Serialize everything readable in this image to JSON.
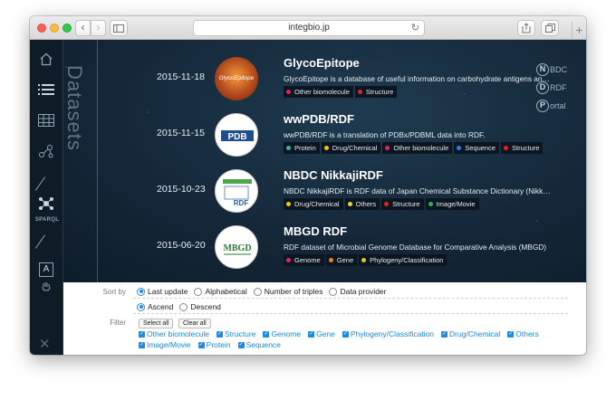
{
  "browser": {
    "url": "integbio.jp",
    "back": "‹",
    "forward": "›",
    "reload": "↻",
    "new_tab": "+"
  },
  "sidebar": {
    "sparql_label": "SPARQL",
    "box_label": "A",
    "vertical_title": "Datasets"
  },
  "logo": {
    "letters": [
      "N",
      "D",
      "P"
    ],
    "words": [
      "BDC",
      "RDF",
      "ortal"
    ]
  },
  "datasets": [
    {
      "date": "2015-11-18",
      "title": "GlycoEpitope",
      "thumb_text": "GlycoEpitope",
      "description": "GlycoEpitope is a database of useful information on carbohydrate antigens and...",
      "tags": [
        {
          "label": "Other biomolecule",
          "color": "#e2245e"
        },
        {
          "label": "Structure",
          "color": "#e22424"
        }
      ]
    },
    {
      "date": "2015-11-15",
      "title": "wwPDB/RDF",
      "thumb_text": "PDB",
      "description": "wwPDB/RDF is a translation of PDBx/PDBML data into RDF.",
      "tags": [
        {
          "label": "Protein",
          "color": "#2ab7a9"
        },
        {
          "label": "Drug/Chemical",
          "color": "#f0c419"
        },
        {
          "label": "Other biomolecule",
          "color": "#e2245e"
        },
        {
          "label": "Sequence",
          "color": "#2a7fe0"
        },
        {
          "label": "Structure",
          "color": "#e22424"
        }
      ]
    },
    {
      "date": "2015-10-23",
      "title": "NBDC NikkajiRDF",
      "thumb_text": "RDF",
      "description": "NBDC NikkajiRDF is RDF data of Japan Chemical Substance Dictionary (Nikkaji).",
      "tags": [
        {
          "label": "Drug/Chemical",
          "color": "#f0c419"
        },
        {
          "label": "Others",
          "color": "#e8d24a"
        },
        {
          "label": "Structure",
          "color": "#e22424"
        },
        {
          "label": "Image/Movie",
          "color": "#36b24a"
        }
      ]
    },
    {
      "date": "2015-06-20",
      "title": "MBGD RDF",
      "thumb_text": "MBGD",
      "description": "RDF dataset of Microbial Genome Database for Comparative Analysis (MBGD)",
      "tags": [
        {
          "label": "Genome",
          "color": "#e2245e"
        },
        {
          "label": "Gene",
          "color": "#ef7d1a"
        },
        {
          "label": "Phylogeny/Classification",
          "color": "#f0c419"
        }
      ]
    }
  ],
  "sort": {
    "label": "Sort by",
    "options": [
      "Last update",
      "Alphabetical",
      "Number of triples",
      "Data provider"
    ],
    "selected": "Last update",
    "order_options": [
      "Ascend",
      "Descend"
    ],
    "order_selected": "Ascend"
  },
  "filter": {
    "label": "Filter",
    "select_all": "Select all",
    "clear_all": "Clear all",
    "items_row1": [
      "Other biomolecule",
      "Structure",
      "Genome",
      "Gene",
      "Phylogeny/Classification",
      "Drug/Chemical",
      "Others"
    ],
    "items_row2": [
      "Image/Movie",
      "Protein",
      "Sequence"
    ]
  },
  "close_icon": "✕"
}
